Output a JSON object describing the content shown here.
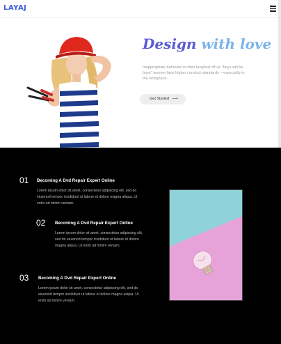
{
  "header": {
    "logo": "LAYAJ",
    "menu_icon": "hamburger-menu-icon"
  },
  "hero": {
    "title_part1": "Design ",
    "title_part2": "with love",
    "text": "Inappropriate behavior is often laughed off as \"boys will be boys\" women face higher conduct standards – especially in the workplace.",
    "button_label": "Get Started",
    "button_icon": "arrow-right-icon",
    "image": "woman-with-hard-hat-and-pliers"
  },
  "features": [
    {
      "number": "01",
      "title": "Becoming A Dvd Repair Expert Online",
      "desc": "Lorem ipsum dolor sit amet, consectetur adipiscing elit, sed do eiusmod tempor incididunt ut labore et dolore magna aliqua. Ut enim ad minim veniam."
    },
    {
      "number": "02",
      "title": "Becoming A Dvd Repair Expert Online",
      "desc": "Lorem ipsum dolor sit amet, consectetur adipiscing elit, sed do eiusmod tempor incididunt ut labore et dolore magna aliqua. Ut enim ad minim veniam."
    },
    {
      "number": "03",
      "title": "Becoming A Dvd Repair Expert Online",
      "desc": "Lorem ipsum dolor sit amet, consectetur adipiscing elit, sed do eiusmod tempor incididunt ut labore et dolore magna aliqua. Ut enim ad minim veniam."
    }
  ],
  "colors": {
    "accent": "#5b5bd6",
    "accent_light": "#7db3ea",
    "dark_bg": "#000000",
    "image_top": "#8fd3d8",
    "image_bottom": "#e7a3d9"
  },
  "side_image": "light-bulb-on-pastel-background"
}
